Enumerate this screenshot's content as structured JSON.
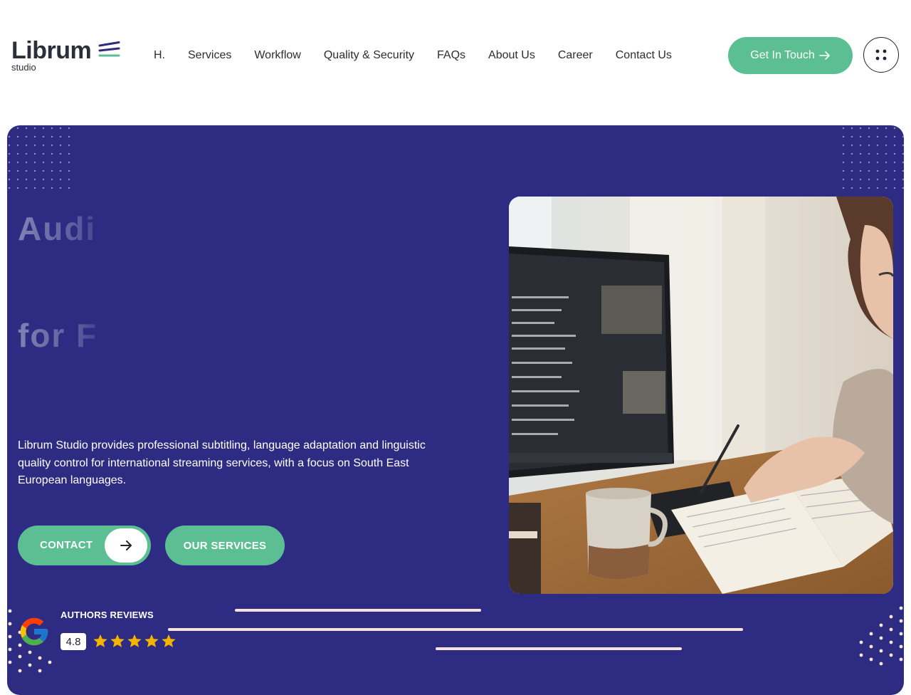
{
  "brand": {
    "name": "Librum",
    "sub": "studio",
    "line_colors": [
      "#2d2c82",
      "#5bbf93"
    ]
  },
  "nav": {
    "items": [
      {
        "label": "H."
      },
      {
        "label": "Services"
      },
      {
        "label": "Workflow"
      },
      {
        "label": "Quality & Security"
      },
      {
        "label": "FAQs"
      },
      {
        "label": "About Us"
      },
      {
        "label": "Career"
      },
      {
        "label": "Contact Us"
      }
    ],
    "cta_label": "Get In Touch",
    "cta_icon": "arrow-right-icon",
    "menu_icon": "dots-grid-icon"
  },
  "hero": {
    "headline_line1": "Audi",
    "headline_line2": "for F",
    "description": "Librum Studio provides professional subtitling, language adaptation and linguistic quality control for international streaming services, with a focus on South East European languages.",
    "contact_label": "CONTACT",
    "services_label": "OUR SERVICES",
    "photo_icon": "person-at-desk-with-monitor-photo"
  },
  "reviews": {
    "title": "AUTHORS REVIEWS",
    "rating": "4.8",
    "stars": 5,
    "icon": "google-g-icon"
  },
  "colors": {
    "accent": "#5bbf93",
    "hero_bg": "#2d2c82",
    "star": "#f5b301",
    "deco_line": "#f6e4d9"
  }
}
